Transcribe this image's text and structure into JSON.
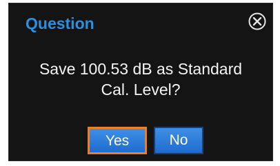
{
  "dialog": {
    "title": "Question",
    "close_icon": "circled-x-icon",
    "message_line1": "Save 100.53 dB as Standard",
    "message_line2": "Cal. Level?",
    "yes_label": "Yes",
    "no_label": "No"
  },
  "colors": {
    "background": "#141414",
    "title": "#2d8fe0",
    "text": "#f4f4f4",
    "button": "#2a7cdc",
    "focus_border": "#f07d22"
  }
}
